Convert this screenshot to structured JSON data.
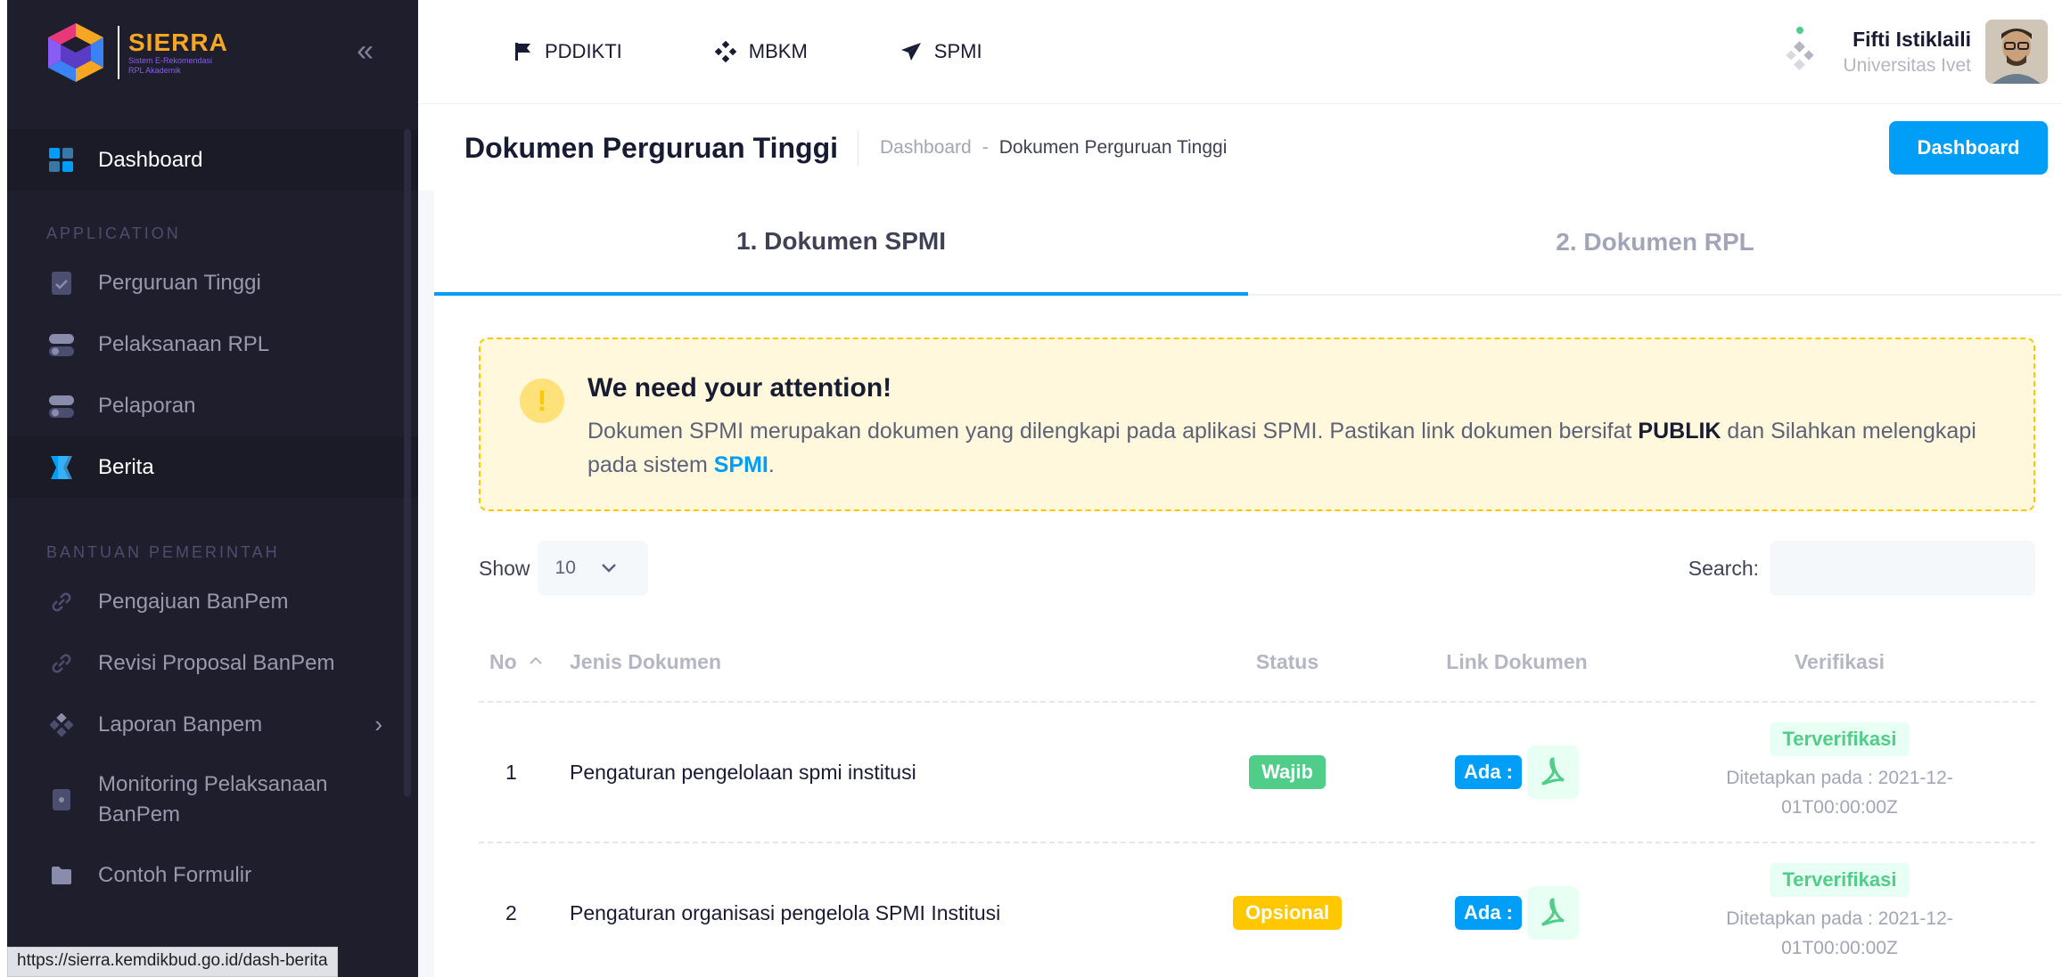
{
  "logo": {
    "title": "SIERRA",
    "subtitle_line1": "Sistem E-Rekomendasi",
    "subtitle_line2": "RPL Akademik"
  },
  "sidebar": {
    "collapse_icon": "double-chevron-left-icon",
    "dashboard_label": "Dashboard",
    "section_application": "APPLICATION",
    "application_items": [
      {
        "label": "Perguruan Tinggi",
        "icon": "document-check-icon"
      },
      {
        "label": "Pelaksanaan RPL",
        "icon": "toggle-icon"
      },
      {
        "label": "Pelaporan",
        "icon": "toggle-icon"
      },
      {
        "label": "Berita",
        "icon": "ribbon-icon",
        "active": true
      }
    ],
    "section_bantuan": "BANTUAN PEMERINTAH",
    "bantuan_items": [
      {
        "label": "Pengajuan BanPem",
        "icon": "link-icon"
      },
      {
        "label": "Revisi Proposal BanPem",
        "icon": "link-icon"
      },
      {
        "label": "Laporan Banpem",
        "icon": "diamond-dots-icon"
      },
      {
        "label_line1": "Monitoring Pelaksanaan",
        "label_line2": "BanPem",
        "icon": "file-icon"
      },
      {
        "label": "Contoh Formulir",
        "icon": "folder-icon"
      }
    ]
  },
  "topnav": [
    {
      "label": "PDDIKTI",
      "icon": "flag-icon"
    },
    {
      "label": "MBKM",
      "icon": "diamond-dots-icon"
    },
    {
      "label": "SPMI",
      "icon": "send-icon"
    }
  ],
  "user": {
    "name": "Fifti Istiklaili",
    "org": "Universitas Ivet"
  },
  "toolbar": {
    "page_title": "Dokumen Perguruan Tinggi",
    "breadcrumb_home": "Dashboard",
    "breadcrumb_sep": "-",
    "breadcrumb_current": "Dokumen Perguruan Tinggi",
    "dashboard_button": "Dashboard"
  },
  "tabs": [
    {
      "label": "1. Dokumen SPMI",
      "active": true
    },
    {
      "label": "2. Dokumen RPL",
      "active": false
    }
  ],
  "alert": {
    "icon": "exclamation-icon",
    "title": "We need your attention!",
    "text_part1": "Dokumen SPMI merupakan dokumen yang dilengkapi pada aplikasi SPMI. Pastikan link dokumen bersifat ",
    "text_bold": "PUBLIK",
    "text_part2": " dan Silahkan melengkapi pada sistem ",
    "text_link": "SPMI",
    "text_end": "."
  },
  "table_controls": {
    "show_label": "Show",
    "show_value": "10",
    "search_label": "Search:",
    "search_value": ""
  },
  "table": {
    "headers": {
      "no": "No",
      "jenis": "Jenis Dokumen",
      "status": "Status",
      "link": "Link Dokumen",
      "verifikasi": "Verifikasi"
    },
    "rows": [
      {
        "no": "1",
        "jenis": "Pengaturan pengelolaan spmi institusi",
        "status": "Wajib",
        "link": "Ada :",
        "verif": "Terverifikasi",
        "date_line1": "Ditetapkan pada : 2021-12-",
        "date_line2": "01T00:00:00Z"
      },
      {
        "no": "2",
        "jenis": "Pengaturan organisasi pengelola SPMI Institusi",
        "status": "Opsional",
        "link": "Ada :",
        "verif": "Terverifikasi",
        "date_line1": "Ditetapkan pada : 2021-12-",
        "date_line2": "01T00:00:00Z"
      }
    ]
  },
  "status_url": "https://sierra.kemdikbud.go.id/dash-berita",
  "colors": {
    "sidebar_bg": "#1e1e2d",
    "primary": "#009ef7",
    "success": "#50cd89",
    "warning": "#ffc700"
  }
}
